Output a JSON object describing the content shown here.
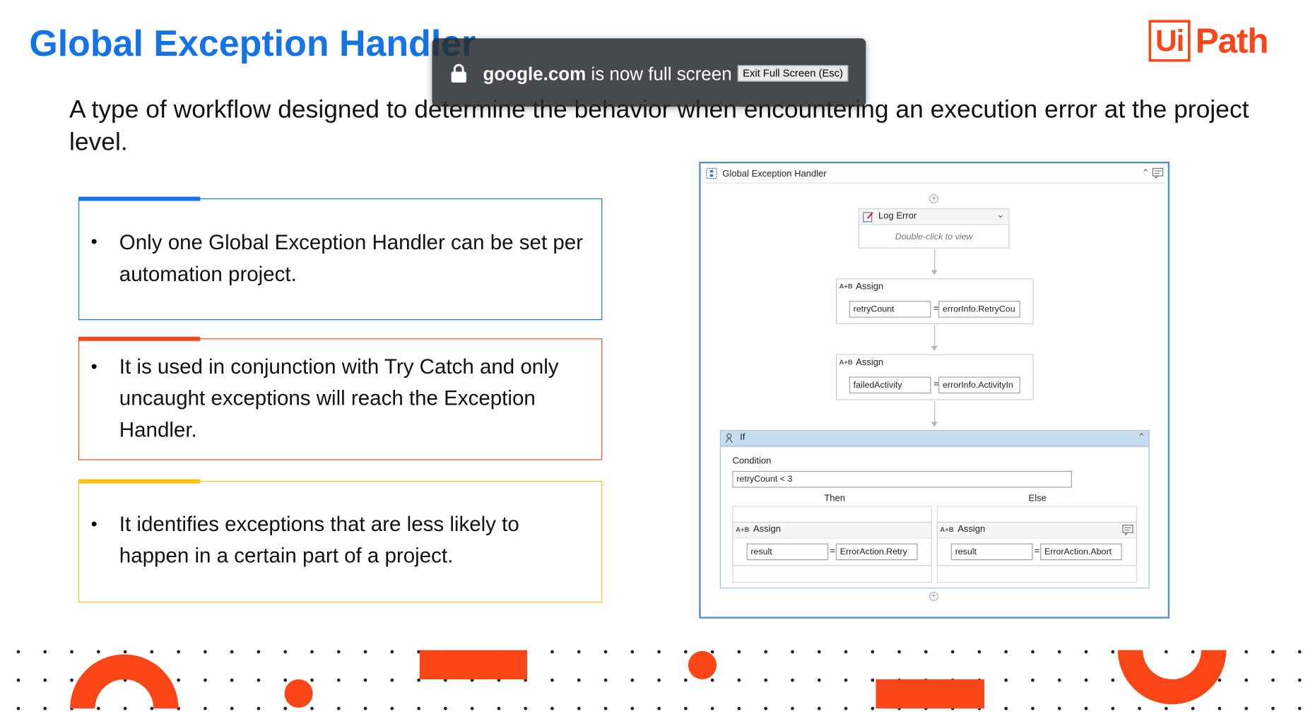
{
  "slide": {
    "title": "Global Exception Handler",
    "subtitle": "A type of workflow designed to determine the behavior when encountering an execution error at the project level."
  },
  "logo": {
    "box_text": "Ui",
    "path_text": "Path",
    "color": "#fa4616"
  },
  "cards": [
    {
      "bullet": "•",
      "text": "Only one Global Exception Handler can be set per automation project.",
      "accent": "#1473e6"
    },
    {
      "bullet": "•",
      "text": "It is used in conjunction with Try Catch and only uncaught exceptions will reach the Exception Handler.",
      "accent": "#fa4616"
    },
    {
      "bullet": "•",
      "text": "It identifies exceptions that are less likely to happen in a certain part of a project.",
      "accent": "#fbbf0f"
    }
  ],
  "fullscreen_banner": {
    "domain": "google.com",
    "message": " is now full screen",
    "exit_label": "Exit Full Screen (Esc)"
  },
  "workflow": {
    "title": "Global Exception Handler",
    "log_error": {
      "title": "Log Error",
      "hint": "Double-click to view"
    },
    "assign1": {
      "title": "Assign",
      "left": "retryCount",
      "right": "errorInfo.RetryCou"
    },
    "assign2": {
      "title": "Assign",
      "left": "failedActivity",
      "right": "errorInfo.ActivityIn"
    },
    "if_block": {
      "title": "If",
      "condition_label": "Condition",
      "condition": "retryCount < 3",
      "then_label": "Then",
      "else_label": "Else",
      "then_assign": {
        "title": "Assign",
        "left": "result",
        "right": "ErrorAction.Retry"
      },
      "else_assign": {
        "title": "Assign",
        "left": "result",
        "right": "ErrorAction.Abort"
      }
    },
    "assign_icon_text": "A+B",
    "equals": "="
  },
  "colors": {
    "title_blue": "#1473e6",
    "brand_orange": "#fa4616",
    "accent_yellow": "#fbbf0f",
    "if_header": "#c6ddf0"
  }
}
